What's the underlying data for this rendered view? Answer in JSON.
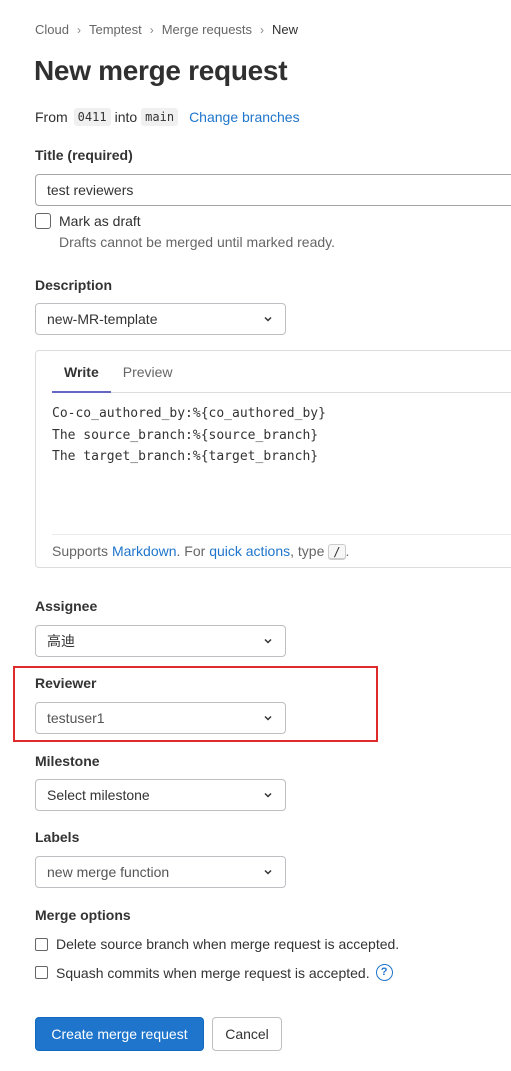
{
  "breadcrumb": {
    "items": [
      "Cloud",
      "Temptest",
      "Merge requests",
      "New"
    ]
  },
  "page_title": "New merge request",
  "branches": {
    "from_label": "From",
    "source": "0411",
    "into_label": "into",
    "target": "main",
    "change_link": "Change branches"
  },
  "title_field": {
    "label": "Title (required)",
    "value": "test reviewers",
    "draft_label": "Mark as draft",
    "draft_help": "Drafts cannot be merged until marked ready."
  },
  "description": {
    "label": "Description",
    "template_value": "new-MR-template",
    "tabs": [
      "Write",
      "Preview"
    ],
    "active_tab": "Write",
    "content": "Co-co_authored_by:%{co_authored_by}\nThe source_branch:%{source_branch}\nThe target_branch:%{target_branch}",
    "footer": {
      "supports": "Supports ",
      "markdown": "Markdown",
      "for": ". For ",
      "quick_actions": "quick actions",
      "type": ", type ",
      "slash": "/",
      "end": "."
    }
  },
  "assignee": {
    "label": "Assignee",
    "value": "高迪"
  },
  "reviewer": {
    "label": "Reviewer",
    "value": "testuser1"
  },
  "milestone": {
    "label": "Milestone",
    "value": "Select milestone"
  },
  "labels": {
    "label": "Labels",
    "value": "new merge function"
  },
  "merge_options": {
    "label": "Merge options",
    "delete_source": "Delete source branch when merge request is accepted.",
    "squash": "Squash commits when merge request is accepted.",
    "help_icon": "?"
  },
  "actions": {
    "create": "Create merge request",
    "cancel": "Cancel"
  },
  "colors": {
    "primary": "#1f75cb",
    "highlight": "#dd2b2b",
    "tab_underline": "#6666c4"
  }
}
